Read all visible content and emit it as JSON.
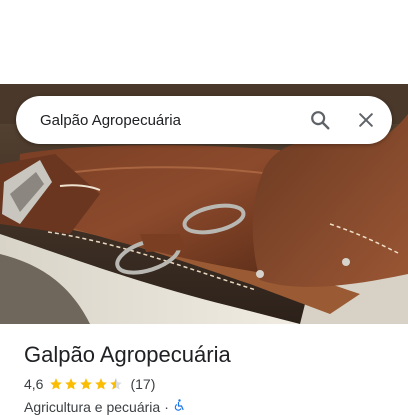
{
  "search": {
    "query": "Galpão Agropecuária"
  },
  "place": {
    "name": "Galpão Agropecuária",
    "rating": "4,6",
    "stars": 4.5,
    "review_count": "(17)",
    "category": "Agricultura e pecuária",
    "separator": "·"
  },
  "icons": {
    "search": "search-icon",
    "close": "close-icon",
    "accessibility": "wheelchair-icon",
    "star": "star-icon"
  },
  "colors": {
    "star": "#fbbc04",
    "accessibility": "#1a73e8",
    "icon_gray": "#5f6368"
  }
}
